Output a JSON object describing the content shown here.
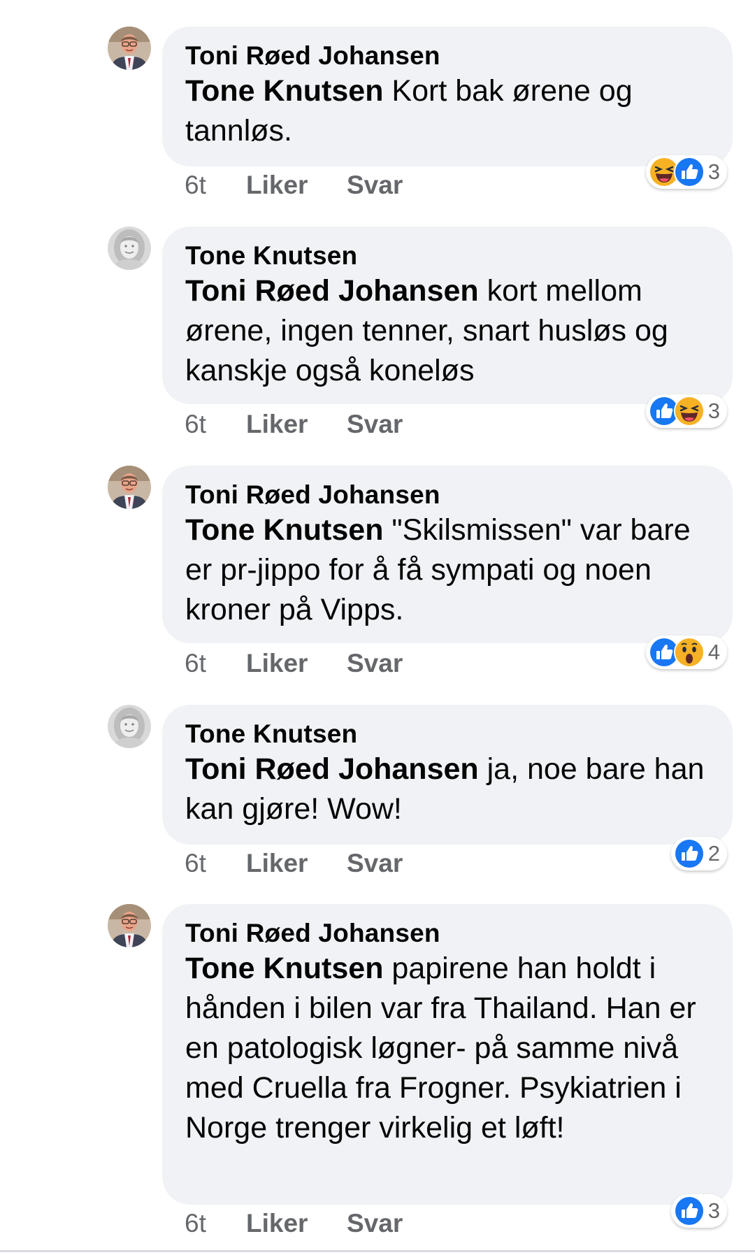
{
  "comments": [
    {
      "author": "Toni Røed Johansen",
      "avatar": "avatar-man",
      "mention": "Tone Knutsen",
      "text": " Kort bak ørene og tannløs.",
      "time": "6t",
      "like_label": "Liker",
      "reply_label": "Svar",
      "reactions": [
        "haha",
        "like"
      ],
      "reaction_count": "3"
    },
    {
      "author": "Tone Knutsen",
      "avatar": "avatar-woman",
      "mention": "Toni Røed Johansen",
      "text": " kort mellom ørene, ingen tenner, snart husløs og kanskje også koneløs",
      "time": "6t",
      "like_label": "Liker",
      "reply_label": "Svar",
      "reactions": [
        "like",
        "haha"
      ],
      "reaction_count": "3"
    },
    {
      "author": "Toni Røed Johansen",
      "avatar": "avatar-man",
      "mention": "Tone Knutsen",
      "text": " \"Skilsmissen\" var bare er pr-jippo for å få sympati og noen kroner på Vipps.",
      "time": "6t",
      "like_label": "Liker",
      "reply_label": "Svar",
      "reactions": [
        "like",
        "wow"
      ],
      "reaction_count": "4"
    },
    {
      "author": "Tone Knutsen",
      "avatar": "avatar-woman",
      "mention": "Toni Røed Johansen",
      "text": " ja, noe bare han kan gjøre! Wow!",
      "time": "6t",
      "like_label": "Liker",
      "reply_label": "Svar",
      "reactions": [
        "like"
      ],
      "reaction_count": "2"
    },
    {
      "author": "Toni Røed Johansen",
      "avatar": "avatar-man",
      "mention": "Tone Knutsen",
      "text": " papirene han holdt i hånden i bilen var fra Thailand. Han er en patologisk løgner- på samme nivå med Cruella fra Frogner. Psykiatrien i Norge trenger virkelig et løft!",
      "time": "6t",
      "like_label": "Liker",
      "reply_label": "Svar",
      "reactions": [
        "like"
      ],
      "reaction_count": "3"
    }
  ],
  "colors": {
    "bubble_bg": "#f0f2f5",
    "meta_text": "#65676b",
    "like_blue": "#1877f2",
    "emoji_yellow": "#f7b125"
  }
}
